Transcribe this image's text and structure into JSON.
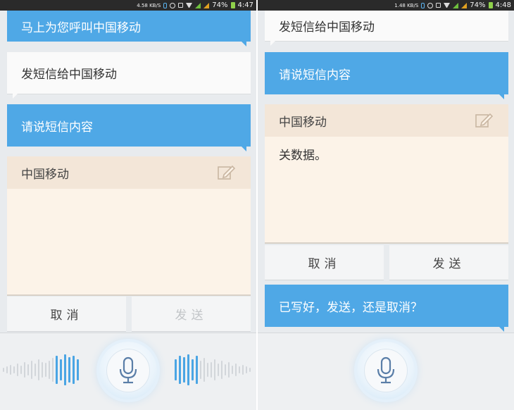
{
  "left_screen": {
    "status": {
      "speed": "4.58 KB/S",
      "battery": "74%",
      "time": "4:47"
    },
    "bubble_call": "马上为您呼叫中国移动",
    "bubble_sms": "发短信给中国移动",
    "bubble_prompt": "请说短信内容",
    "card": {
      "recipient": "中国移动",
      "body": ""
    },
    "buttons": {
      "cancel": "取消",
      "send": "发送"
    },
    "icons": {
      "edit": "pencil-square-icon",
      "mic": "microphone-icon"
    }
  },
  "right_screen": {
    "status": {
      "speed": "1.48 KB/S",
      "battery": "74%",
      "time": "4:48"
    },
    "bubble_sms": "发短信给中国移动",
    "bubble_prompt": "请说短信内容",
    "card": {
      "recipient": "中国移动",
      "body": "关数据。"
    },
    "buttons": {
      "cancel": "取消",
      "send": "发送"
    },
    "bubble_confirm": "已写好，发送，还是取消？",
    "icons": {
      "edit": "pencil-square-icon",
      "mic": "microphone-icon"
    }
  },
  "colors": {
    "accent_blue": "#4fa8e6",
    "card_bg": "#fcf3e8",
    "card_header": "#f3e6d8",
    "wave_active": "#4aa5e4"
  }
}
